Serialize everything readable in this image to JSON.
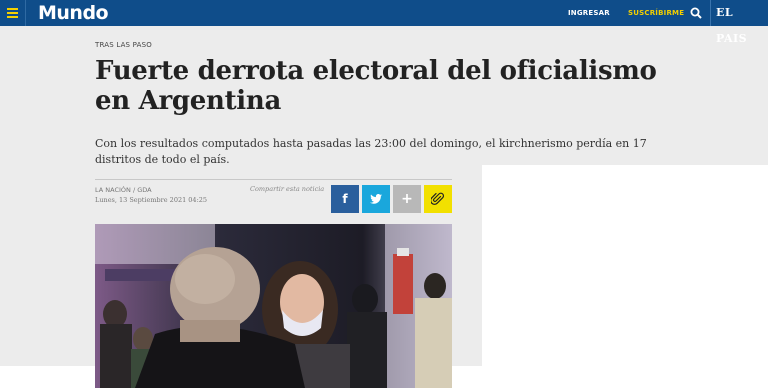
{
  "header": {
    "section_title": "Mundo",
    "login_label": "INGRESAR",
    "subscribe_label": "SUSCRÍBIRME",
    "brand": "EL PAIS"
  },
  "article": {
    "kicker": "TRAS LAS PASO",
    "headline": "Fuerte derrota electoral del oficialismo en Argentina",
    "summary": "Con los resultados computados hasta pasadas las 23:00 del domingo, el kirchnerismo perdía en 17 distritos de todo el país.",
    "source": "LA NACIÓN / GDA",
    "date": "Lunes, 13 Septiembre 2021 04:25",
    "share_label": "Compartir esta noticia"
  },
  "share": {
    "facebook_glyph": "f",
    "twitter_glyph": "t",
    "more_glyph": "+"
  },
  "icons": {
    "menu": "hamburger-icon",
    "search": "search-icon",
    "facebook": "facebook-icon",
    "twitter": "twitter-icon",
    "more": "plus-icon",
    "link": "paperclip-icon"
  },
  "colors": {
    "header_bg": "#0f4d8a",
    "accent_yellow": "#f4d000",
    "facebook": "#2a5f9d",
    "twitter": "#1aa7dc",
    "more": "#b8b8b8",
    "link": "#f2e000"
  }
}
